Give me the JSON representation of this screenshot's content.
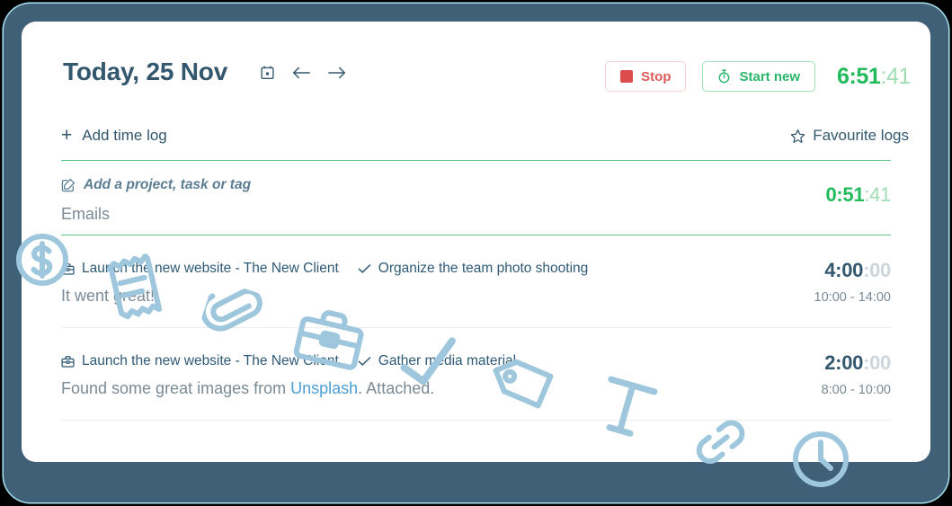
{
  "header": {
    "title": "Today, 25 Nov",
    "calendar_icon": "calendar-icon",
    "prev_icon": "arrow-left-icon",
    "next_icon": "arrow-right-icon",
    "stop_label": "Stop",
    "start_label": "Start new",
    "running_timer": {
      "main": "6:51",
      "seconds": ":41"
    }
  },
  "toolbar": {
    "add_time_log": "Add time log",
    "add_plus": "+",
    "favourite_logs": "Favourite logs"
  },
  "logs": [
    {
      "is_running": true,
      "placeholder": "Add a project, task or tag",
      "note": "Emails",
      "duration_main": "0:51",
      "duration_seconds": ":41",
      "range": ""
    },
    {
      "is_running": false,
      "project": "Launch the new website - The New Client",
      "task": "Organize the team photo shooting",
      "note": "It went great!",
      "duration_main": "4:00",
      "duration_seconds": ":00",
      "range": "10:00 - 14:00"
    },
    {
      "is_running": false,
      "project": "Launch the new website - The New Client",
      "task": "Gather media material",
      "note_prefix": "Found some great images from ",
      "note_link": "Unsplash",
      "note_suffix": ". Attached.",
      "duration_main": "2:00",
      "duration_seconds": ":00",
      "range": "8:00 - 10:00"
    }
  ],
  "colors": {
    "frame": "#3f6077",
    "frame_edge": "#a8e6f2",
    "card": "#ffffff",
    "text_dark": "#33586e",
    "green": "#22bb5b",
    "green_light": "#9fdcb4",
    "green_line": "#5cc98a",
    "red": "#dc4c4c",
    "link": "#4b9fd4",
    "doodle": "#9ec7dd",
    "muted": "#7b8b96"
  },
  "doodles": [
    "dollar-coin-doodle",
    "receipt-doodle",
    "paperclip-doodle",
    "briefcase-doodle",
    "checkmark-doodle",
    "tag-doodle",
    "letter-t-doodle",
    "link-chain-doodle",
    "clock-doodle"
  ]
}
